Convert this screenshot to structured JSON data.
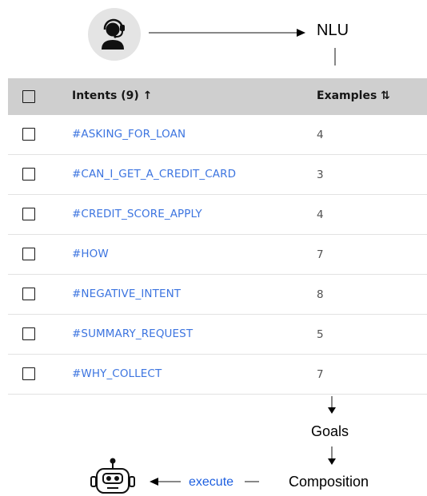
{
  "diagram": {
    "nlu_label": "NLU",
    "goals_label": "Goals",
    "composition_label": "Composition",
    "execute_label": "execute",
    "agent_icon": "support-agent-icon",
    "bot_icon": "robot-icon"
  },
  "table": {
    "header": {
      "intents": "Intents (9) ↑",
      "examples": "Examples ⇅"
    },
    "rows": [
      {
        "intent": "#ASKING_FOR_LOAN",
        "examples": "4"
      },
      {
        "intent": "#CAN_I_GET_A_CREDIT_CARD",
        "examples": "3"
      },
      {
        "intent": "#CREDIT_SCORE_APPLY",
        "examples": "4"
      },
      {
        "intent": "#HOW",
        "examples": "7"
      },
      {
        "intent": "#NEGATIVE_INTENT",
        "examples": "8"
      },
      {
        "intent": "#SUMMARY_REQUEST",
        "examples": "5"
      },
      {
        "intent": "#WHY_COLLECT",
        "examples": "7"
      }
    ]
  },
  "colors": {
    "link": "#3d75e0",
    "header_bg": "#cfcfcf",
    "execute": "#1d5fe0"
  }
}
